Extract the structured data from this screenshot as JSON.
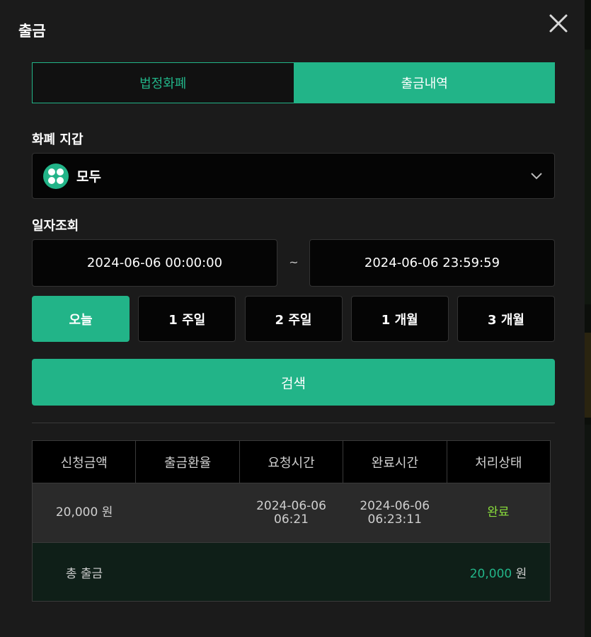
{
  "modal": {
    "title": "출금"
  },
  "tabs": [
    {
      "label": "법정화폐",
      "active": false
    },
    {
      "label": "출금내역",
      "active": true
    }
  ],
  "wallet": {
    "label": "화폐 지갑",
    "selected": "모두"
  },
  "date_query": {
    "label": "일자조회",
    "start": "2024-06-06 00:00:00",
    "separator": "~",
    "end": "2024-06-06 23:59:59"
  },
  "ranges": [
    {
      "label": "오늘",
      "active": true
    },
    {
      "label": "1 주일",
      "active": false
    },
    {
      "label": "2 주일",
      "active": false
    },
    {
      "label": "1 개월",
      "active": false
    },
    {
      "label": "3 개월",
      "active": false
    }
  ],
  "search_label": "검색",
  "table": {
    "headers": [
      "신청금액",
      "출금환율",
      "요청시간",
      "완료시간",
      "처리상태"
    ],
    "rows": [
      {
        "amount": "20,000 원",
        "rate": "",
        "request_date": "2024-06-06",
        "request_time": "06:21",
        "complete_date": "2024-06-06",
        "complete_time": "06:23:11",
        "status": "완료"
      }
    ],
    "total": {
      "label": "총 출금",
      "value": "20,000",
      "unit": "원"
    }
  },
  "colors": {
    "accent": "#22b488",
    "status_done": "#8adf3c",
    "background": "#1b1b1b"
  },
  "icons": {
    "close": "close-icon",
    "wallet": "wallet-grid-icon",
    "dropdown": "chevron-down-icon"
  }
}
